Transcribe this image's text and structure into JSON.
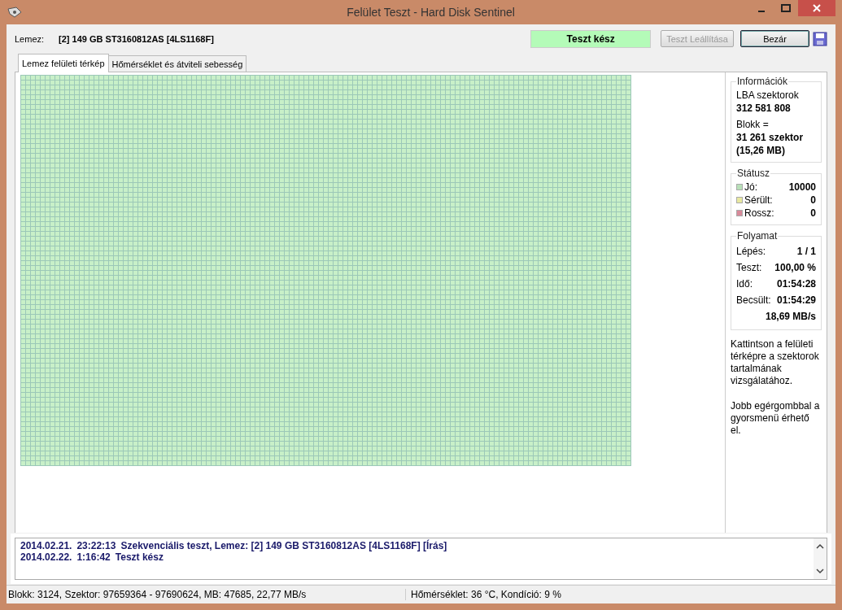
{
  "window": {
    "title": "Felület Teszt - Hard Disk Sentinel"
  },
  "header": {
    "label": "Lemez:",
    "disk": "[2] 149 GB  ST3160812AS [4LS1168F]",
    "status": "Teszt kész",
    "buttons": [
      {
        "label": "Teszt Leállítása",
        "disabled": true
      },
      {
        "label": "Bezár",
        "disabled": false
      }
    ]
  },
  "tabs": [
    {
      "label": "Lemez felületi térkép",
      "selected": true
    },
    {
      "label": "Hőmérséklet és átviteli sebesség",
      "selected": false
    }
  ],
  "info": {
    "title": "Információk",
    "rows": [
      {
        "text": "LBA szektorok",
        "bold": false
      },
      {
        "text": "312 581 808",
        "bold": true
      },
      {
        "text": "Blokk =",
        "bold": false
      },
      {
        "text": "31 261 szektor",
        "bold": true
      },
      {
        "text": "(15,26 MB)",
        "bold": true
      }
    ]
  },
  "status": {
    "title": "Státusz",
    "items": [
      {
        "label": "Jó:",
        "value": "10000",
        "color": "#b8e0b8"
      },
      {
        "label": "Sérült:",
        "value": "0",
        "color": "#e8e8a0"
      },
      {
        "label": "Rossz:",
        "value": "0",
        "color": "#d88a9a"
      }
    ]
  },
  "progress": {
    "title": "Folyamat",
    "rows": [
      {
        "label": "Lépés:",
        "value": "1 / 1"
      },
      {
        "label": "Teszt:",
        "value": "100,00 %"
      },
      {
        "label": "Idő:",
        "value": "01:54:28"
      },
      {
        "label": "Becsült:",
        "value": "01:54:29"
      },
      {
        "label": "",
        "value": "18,69 MB/s"
      }
    ]
  },
  "hints": [
    "Kattintson a felületi térképre a szektorok tartalmának vizsgálatához.",
    "Jobb egérgombbal a gyorsmenü érhető el."
  ],
  "log": [
    {
      "date": "2014.02.21.",
      "time": "23:22:13",
      "message": "Szekvenciális teszt, Lemez: [2] 149 GB  ST3160812AS [4LS1168F] [Írás]"
    },
    {
      "date": "2014.02.22.",
      "time": "1:16:42",
      "message": "Teszt kész"
    }
  ],
  "status_bar": [
    "Blokk: 3124, Szektor: 97659364 - 97690624, MB: 47685, 22,77 MB/s",
    "Hőmérséklet: 36  °C,  Kondíció: 9 %"
  ]
}
